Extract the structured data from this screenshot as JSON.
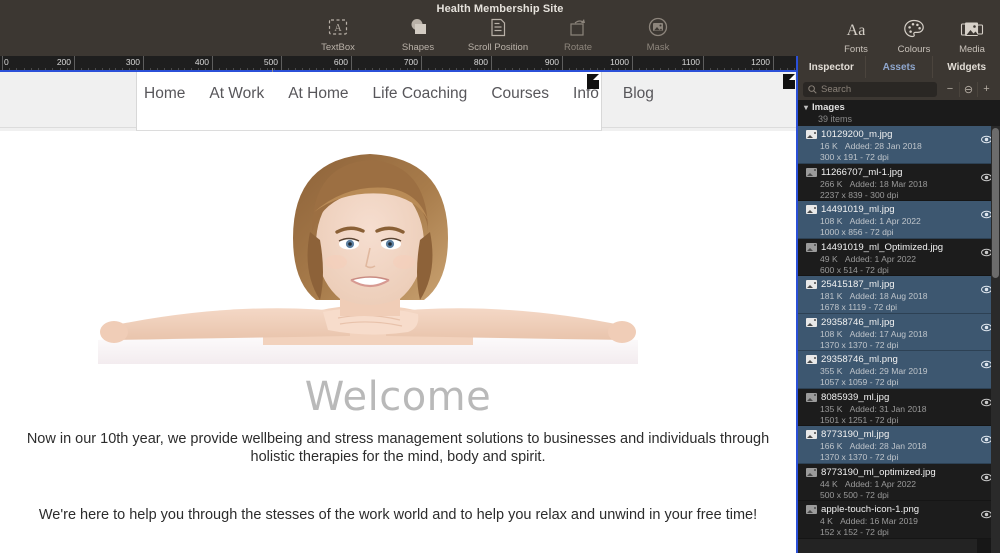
{
  "window": {
    "title": "Health Membership Site"
  },
  "toolbar": {
    "center_items": [
      {
        "label": "TextBox",
        "icon": "textbox-icon",
        "dim": false
      },
      {
        "label": "Shapes",
        "icon": "shapes-icon",
        "dim": false
      },
      {
        "label": "Scroll Position",
        "icon": "scroll-position-icon",
        "dim": false
      },
      {
        "label": "Rotate",
        "icon": "rotate-icon",
        "dim": true
      },
      {
        "label": "Mask",
        "icon": "mask-icon",
        "dim": true
      }
    ],
    "right_items": [
      {
        "label": "Fonts",
        "icon": "fonts-icon"
      },
      {
        "label": "Colours",
        "icon": "colours-palette-icon"
      },
      {
        "label": "Media",
        "icon": "media-icon"
      }
    ]
  },
  "ruler": {
    "unit_labels": [
      "0",
      "200",
      "300",
      "400",
      "500",
      "600",
      "700",
      "800",
      "900",
      "1000",
      "1100",
      "1200"
    ],
    "accent_color": "#2b50d8"
  },
  "canvas": {
    "nav": {
      "items": [
        "Home",
        "At Work",
        "At Home",
        "Life Coaching",
        "Courses",
        "Info",
        "Blog"
      ]
    },
    "heading": "Welcome",
    "paragraph_1": "Now in our 10th year, we provide wellbeing and stress management solutions to businesses and individuals through holistic therapies for the mind, body and spirit.",
    "paragraph_2": "We're here to help you through the stesses of the work world and to help you relax and unwind in your free time!"
  },
  "right_panel": {
    "tabs": [
      {
        "label": "Inspector",
        "active": false
      },
      {
        "label": "Assets",
        "active": true
      },
      {
        "label": "Widgets",
        "active": false
      }
    ],
    "search": {
      "placeholder": "Search",
      "icon": "search-icon"
    },
    "buttons": [
      {
        "label": "−",
        "name": "remove-asset-button"
      },
      {
        "label": "⊖",
        "name": "options-button"
      },
      {
        "label": "+",
        "name": "add-asset-button"
      }
    ],
    "group": {
      "name": "Images",
      "count": "39 items"
    },
    "assets": [
      {
        "name": "10129200_m.jpg",
        "size": "16 K",
        "added": "Added: 28 Jan 2018",
        "dims": "300 x 191 - 72 dpi",
        "selected": true
      },
      {
        "name": "11266707_ml-1.jpg",
        "size": "266 K",
        "added": "Added: 18 Mar 2018",
        "dims": "2237 x 839 - 300 dpi",
        "selected": false
      },
      {
        "name": "14491019_ml.jpg",
        "size": "108 K",
        "added": "Added: 1 Apr 2022",
        "dims": "1000 x 856 - 72 dpi",
        "selected": true
      },
      {
        "name": "14491019_ml_Optimized.jpg",
        "size": "49 K",
        "added": "Added: 1 Apr 2022",
        "dims": "600 x 514 - 72 dpi",
        "selected": false
      },
      {
        "name": "25415187_ml.jpg",
        "size": "181 K",
        "added": "Added: 18 Aug 2018",
        "dims": "1678 x 1119 - 72 dpi",
        "selected": true
      },
      {
        "name": "29358746_ml.jpg",
        "size": "108 K",
        "added": "Added: 17 Aug 2018",
        "dims": "1370 x 1370 - 72 dpi",
        "selected": true
      },
      {
        "name": "29358746_ml.png",
        "size": "355 K",
        "added": "Added: 29 Mar 2019",
        "dims": "1057 x 1059 - 72 dpi",
        "selected": true
      },
      {
        "name": "8085939_ml.jpg",
        "size": "135 K",
        "added": "Added: 31 Jan 2018",
        "dims": "1501 x 1251 - 72 dpi",
        "selected": false
      },
      {
        "name": "8773190_ml.jpg",
        "size": "166 K",
        "added": "Added: 28 Jan 2018",
        "dims": "1370 x 1370 - 72 dpi",
        "selected": true
      },
      {
        "name": "8773190_ml_optimized.jpg",
        "size": "44 K",
        "added": "Added: 1 Apr 2022",
        "dims": "500 x 500 - 72 dpi",
        "selected": false
      },
      {
        "name": "apple-touch-icon-1.png",
        "size": "4 K",
        "added": "Added: 16 Mar 2019",
        "dims": "152 x 152 - 72 dpi",
        "selected": false
      }
    ]
  }
}
